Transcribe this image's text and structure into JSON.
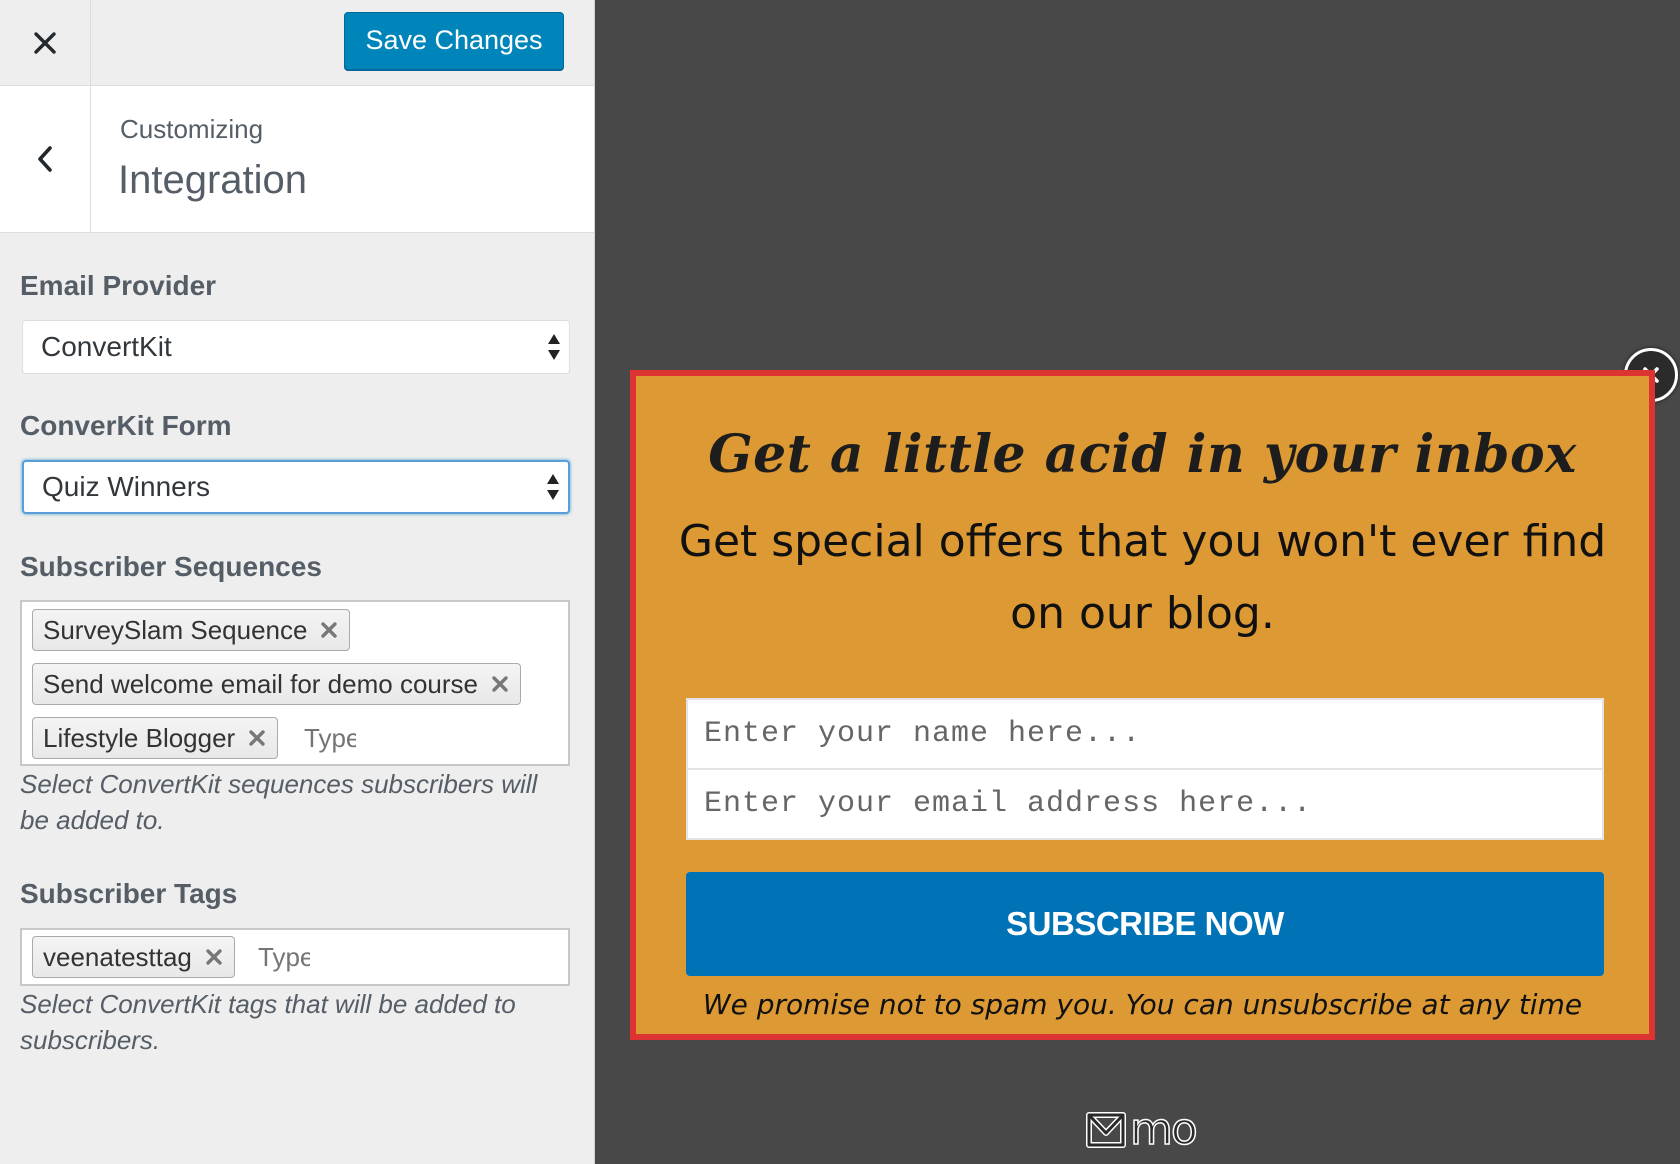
{
  "customizer": {
    "save_label": "Save Changes",
    "header_sub": "Customizing",
    "header_title": "Integration",
    "email_provider": {
      "label": "Email Provider",
      "selected": "ConvertKit"
    },
    "convertkit_form": {
      "label": "ConverKit Form",
      "selected": "Quiz Winners"
    },
    "subscriber_sequences": {
      "label": "Subscriber Sequences",
      "tags": [
        "SurveySlam Sequence",
        "Send welcome email for demo course",
        "Lifestyle Blogger"
      ],
      "input_placeholder": "Type",
      "description": "Select ConvertKit sequences subscribers will be added to."
    },
    "subscriber_tags": {
      "label": "Subscriber Tags",
      "tags": [
        "veenatesttag"
      ],
      "input_placeholder": "Type",
      "description": "Select ConvertKit tags that will be added to subscribers."
    }
  },
  "popup": {
    "headline": "Get a little acid in your inbox",
    "subheadline": "Get special offers that you won't ever find on our blog.",
    "name_placeholder": "Enter your name here...",
    "email_placeholder": "Enter your email address here...",
    "button_label": "SUBSCRIBE NOW",
    "note": "We promise not to spam you. You can unsubscribe at any time",
    "colors": {
      "background": "#dd9933",
      "border": "#dd3333",
      "button": "#0073b7"
    }
  },
  "branding": {
    "logo_text": "mo"
  },
  "icons": [
    "close-icon",
    "chevron-left-icon",
    "select-arrows-icon",
    "tag-remove-icon",
    "popup-close-icon",
    "mo-logo-icon"
  ]
}
